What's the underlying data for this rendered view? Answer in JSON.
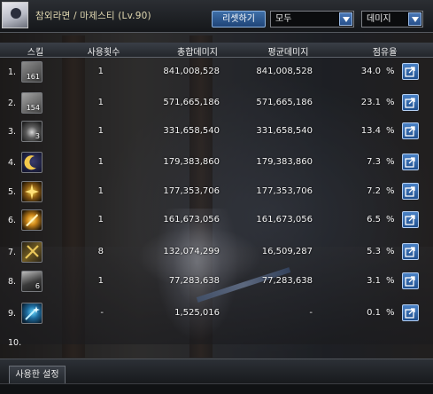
{
  "header": {
    "character_name": "참외라면 / 마제스티 (Lv.90)",
    "reset_label": "리셋하기",
    "scope_select": "모두",
    "metric_select": "데미지"
  },
  "columns": {
    "skill": "스킬",
    "uses": "사용횟수",
    "total": "총합데미지",
    "avg": "평균데미지",
    "share": "점유율"
  },
  "rows": [
    {
      "index": "1.",
      "icon": "skill-1-icon",
      "icon_text": "161",
      "uses": "1",
      "total": "841,008,528",
      "avg": "841,008,528",
      "share": "34.0",
      "pct": "%"
    },
    {
      "index": "2.",
      "icon": "skill-2-icon",
      "icon_text": "154",
      "uses": "1",
      "total": "571,665,186",
      "avg": "571,665,186",
      "share": "23.1",
      "pct": "%"
    },
    {
      "index": "3.",
      "icon": "skill-3-icon",
      "icon_text": "3",
      "uses": "1",
      "total": "331,658,540",
      "avg": "331,658,540",
      "share": "13.4",
      "pct": "%"
    },
    {
      "index": "4.",
      "icon": "skill-4-icon",
      "icon_text": "",
      "uses": "1",
      "total": "179,383,860",
      "avg": "179,383,860",
      "share": "7.3",
      "pct": "%"
    },
    {
      "index": "5.",
      "icon": "skill-5-icon",
      "icon_text": "",
      "uses": "1",
      "total": "177,353,706",
      "avg": "177,353,706",
      "share": "7.2",
      "pct": "%"
    },
    {
      "index": "6.",
      "icon": "skill-6-icon",
      "icon_text": "",
      "uses": "1",
      "total": "161,673,056",
      "avg": "161,673,056",
      "share": "6.5",
      "pct": "%"
    },
    {
      "index": "7.",
      "icon": "skill-7-icon",
      "icon_text": "",
      "uses": "8",
      "total": "132,074,299",
      "avg": "16,509,287",
      "share": "5.3",
      "pct": "%"
    },
    {
      "index": "8.",
      "icon": "skill-8-icon",
      "icon_text": "6",
      "uses": "1",
      "total": "77,283,638",
      "avg": "77,283,638",
      "share": "3.1",
      "pct": "%"
    },
    {
      "index": "9.",
      "icon": "skill-9-icon",
      "icon_text": "",
      "uses": "-",
      "total": "1,525,016",
      "avg": "-",
      "share": "0.1",
      "pct": "%"
    }
  ],
  "row10_index": "10.",
  "footer": {
    "settings_tab": "사용한 설정"
  }
}
